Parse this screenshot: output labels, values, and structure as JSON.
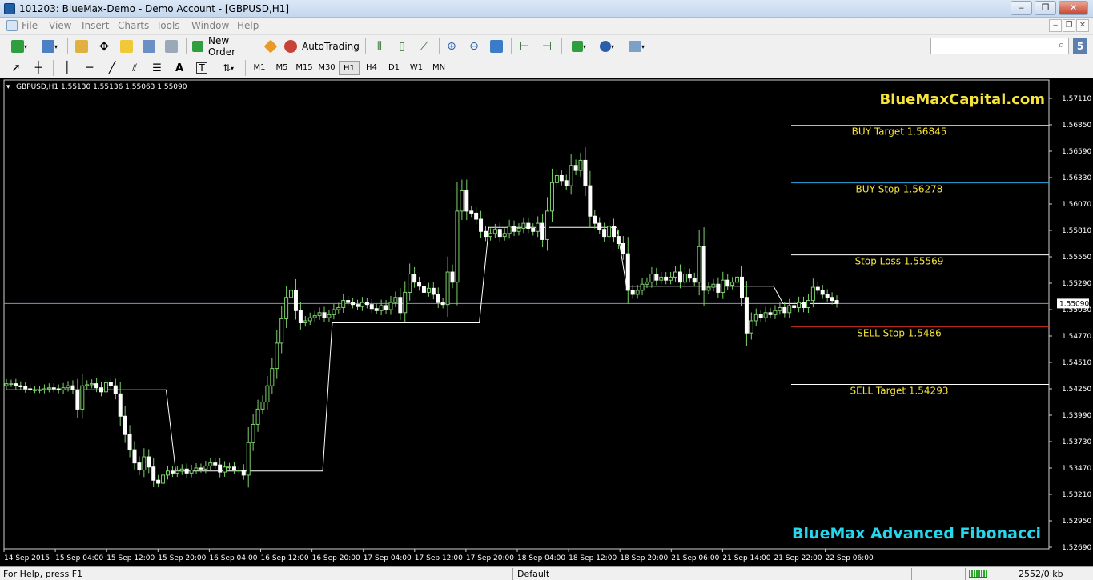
{
  "window": {
    "title": "101203: BlueMax-Demo - Demo Account - [GBPUSD,H1]"
  },
  "menu": [
    "File",
    "View",
    "Insert",
    "Charts",
    "Tools",
    "Window",
    "Help"
  ],
  "toolbar": {
    "new_order": "New Order",
    "autotrading": "AutoTrading"
  },
  "timeframes": [
    "M1",
    "M5",
    "M15",
    "M30",
    "H1",
    "H4",
    "D1",
    "W1",
    "MN"
  ],
  "active_timeframe": "H1",
  "chart": {
    "symbol_info": "GBPUSD,H1  1.55130 1.55136 1.55063 1.55090",
    "brand": "BlueMaxCapital.com",
    "indicator_label": "BlueMax Advanced Fibonacci",
    "current_price_label": "1.55090",
    "levels": [
      {
        "label": "BUY Target  1.56845",
        "price": 1.56845,
        "color": "#e8e050"
      },
      {
        "label": "BUY Stop     1.56278",
        "price": 1.56278,
        "color": "#2fa8e0"
      },
      {
        "label": "Stop Loss    1.55569",
        "price": 1.55569,
        "color": "#ffffff"
      },
      {
        "label": "SELL Stop    1.5486",
        "price": 1.5486,
        "color": "#d03020"
      },
      {
        "label": "SELL Target 1.54293",
        "price": 1.54293,
        "color": "#ffffff"
      }
    ]
  },
  "chart_data": {
    "type": "candlestick",
    "symbol": "GBPUSD",
    "timeframe": "H1",
    "ylim": [
      1.5262,
      1.5716
    ],
    "y_ticks": [
      "1.57110",
      "1.56850",
      "1.56590",
      "1.56330",
      "1.56070",
      "1.55810",
      "1.55550",
      "1.55290",
      "1.55030",
      "1.54770",
      "1.54510",
      "1.54250",
      "1.53990",
      "1.53730",
      "1.53470",
      "1.53210",
      "1.52950",
      "1.52690"
    ],
    "x_ticks": [
      "14 Sep 2015",
      "15 Sep 04:00",
      "15 Sep 12:00",
      "15 Sep 20:00",
      "16 Sep 04:00",
      "16 Sep 12:00",
      "16 Sep 20:00",
      "17 Sep 04:00",
      "17 Sep 12:00",
      "17 Sep 20:00",
      "18 Sep 04:00",
      "18 Sep 12:00",
      "18 Sep 20:00",
      "21 Sep 06:00",
      "21 Sep 14:00",
      "21 Sep 22:00",
      "22 Sep 06:00"
    ],
    "close": [
      1.543,
      1.543,
      1.5428,
      1.5427,
      1.5425,
      1.5424,
      1.5424,
      1.5424,
      1.5425,
      1.5426,
      1.5425,
      1.5424,
      1.5426,
      1.5428,
      1.5424,
      1.5405,
      1.5428,
      1.5429,
      1.543,
      1.5426,
      1.5422,
      1.5431,
      1.5428,
      1.542,
      1.5398,
      1.538,
      1.5365,
      1.5352,
      1.5345,
      1.5358,
      1.5348,
      1.5335,
      1.5332,
      1.534,
      1.5344,
      1.5342,
      1.5344,
      1.5346,
      1.5342,
      1.5345,
      1.5347,
      1.5346,
      1.5349,
      1.5352,
      1.535,
      1.5343,
      1.5348,
      1.5348,
      1.5345,
      1.5345,
      1.534,
      1.5372,
      1.539,
      1.5405,
      1.5412,
      1.5428,
      1.5445,
      1.547,
      1.5494,
      1.5515,
      1.5522,
      1.5502,
      1.549,
      1.5492,
      1.5495,
      1.5497,
      1.55,
      1.5495,
      1.5498,
      1.5503,
      1.5505,
      1.5512,
      1.551,
      1.5508,
      1.5506,
      1.551,
      1.5508,
      1.5504,
      1.5502,
      1.5507,
      1.5503,
      1.551,
      1.5515,
      1.55,
      1.552,
      1.5538,
      1.553,
      1.5526,
      1.552,
      1.5524,
      1.5518,
      1.551,
      1.5508,
      1.554,
      1.553,
      1.56,
      1.562,
      1.56,
      1.5598,
      1.5592,
      1.558,
      1.5575,
      1.5578,
      1.5582,
      1.5575,
      1.5578,
      1.5585,
      1.558,
      1.5583,
      1.5588,
      1.5583,
      1.558,
      1.5588,
      1.5572,
      1.56,
      1.5628,
      1.5635,
      1.563,
      1.5625,
      1.5645,
      1.564,
      1.565,
      1.5625,
      1.5595,
      1.5588,
      1.5582,
      1.5575,
      1.5585,
      1.5575,
      1.5568,
      1.5558,
      1.5522,
      1.5518,
      1.5522,
      1.5528,
      1.553,
      1.5538,
      1.5532,
      1.5535,
      1.5532,
      1.5535,
      1.554,
      1.553,
      1.5538,
      1.5534,
      1.553,
      1.5565,
      1.5522,
      1.5525,
      1.5528,
      1.552,
      1.5532,
      1.5527,
      1.553,
      1.5535,
      1.5515,
      1.548,
      1.5492,
      1.5498,
      1.5495,
      1.55,
      1.5498,
      1.5502,
      1.5505,
      1.55,
      1.5507,
      1.5505,
      1.551,
      1.5505,
      1.5512,
      1.5525,
      1.5522,
      1.5518,
      1.5515,
      1.5512,
      1.5509
    ]
  },
  "statusbar": {
    "help": "For Help, press F1",
    "profile": "Default",
    "traffic": "2552/0 kb"
  }
}
